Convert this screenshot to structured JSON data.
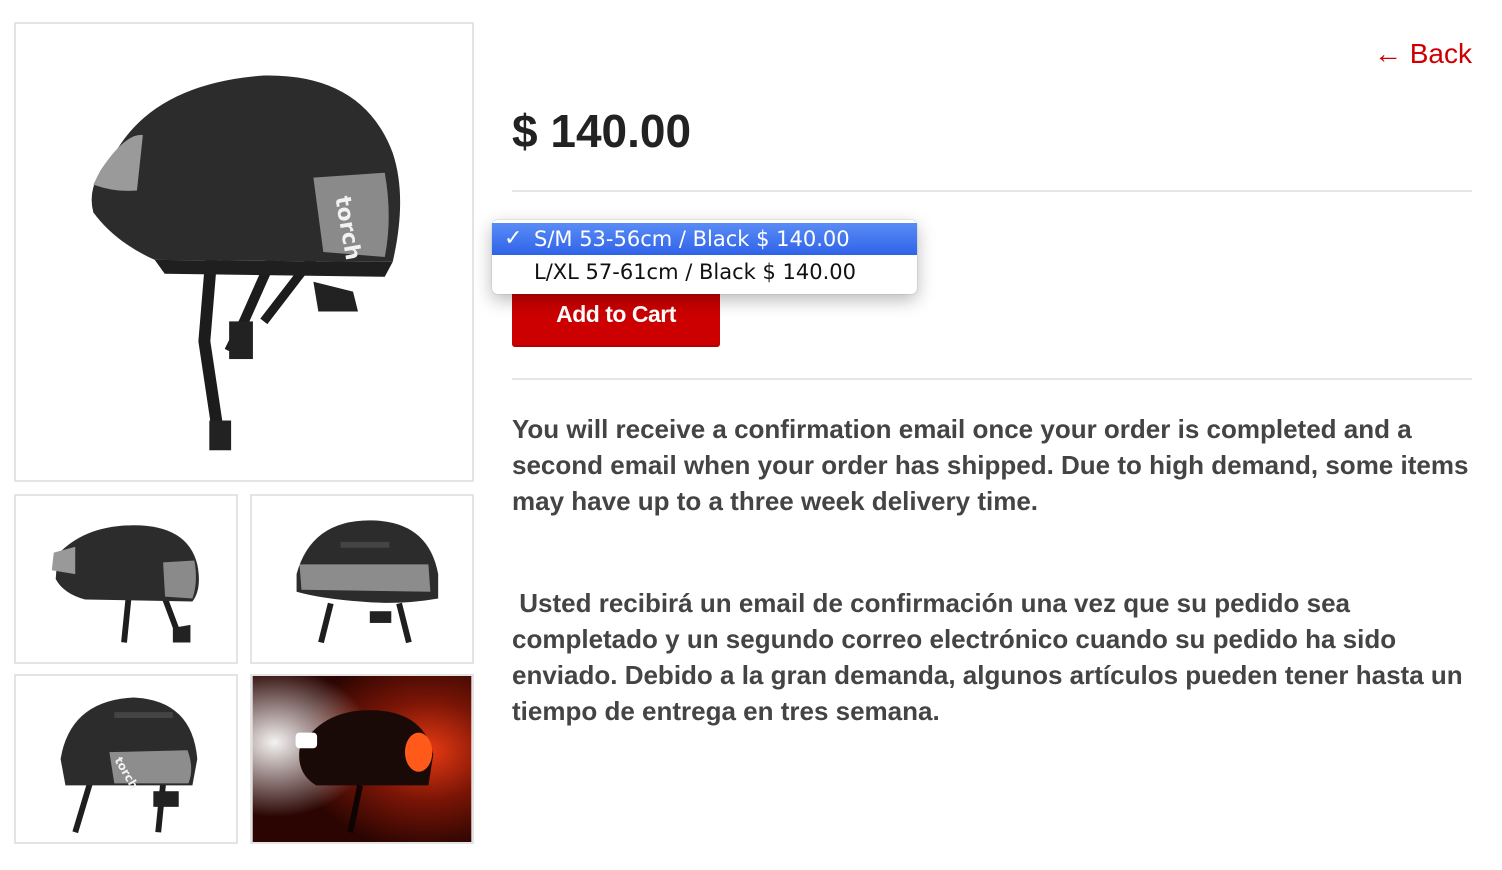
{
  "nav": {
    "back_label": "← Back"
  },
  "product": {
    "price": "$ 140.00"
  },
  "variant_select": {
    "options": [
      {
        "label": "S/M 53-56cm / Black $ 140.00",
        "selected": true
      },
      {
        "label": "L/XL 57-61cm / Black $ 140.00",
        "selected": false
      }
    ],
    "checkmark": "✓"
  },
  "cart": {
    "add_label": "Add to Cart"
  },
  "description": {
    "english": "You will receive a confirmation email once your order is completed and a second email when your order has shipped. Due to high demand, some items may have up to a three week delivery time.",
    "spanish": " Usted recibirá un email de confirmación una vez que su pedido sea completado y un segundo correo electrónico cuando su pedido ha sido enviado. Debido a la gran demanda, algunos artículos pueden tener hasta un tiempo de entrega en tres semana."
  },
  "colors": {
    "accent": "#cc0000",
    "back_link": "#d00000",
    "select_highlight": "#2f63e8"
  },
  "images": {
    "main": "helmet-side-view",
    "thumbnails": [
      "helmet-side-view",
      "helmet-rear-view",
      "helmet-front-angle-view",
      "helmet-lights-on-night-view"
    ]
  }
}
